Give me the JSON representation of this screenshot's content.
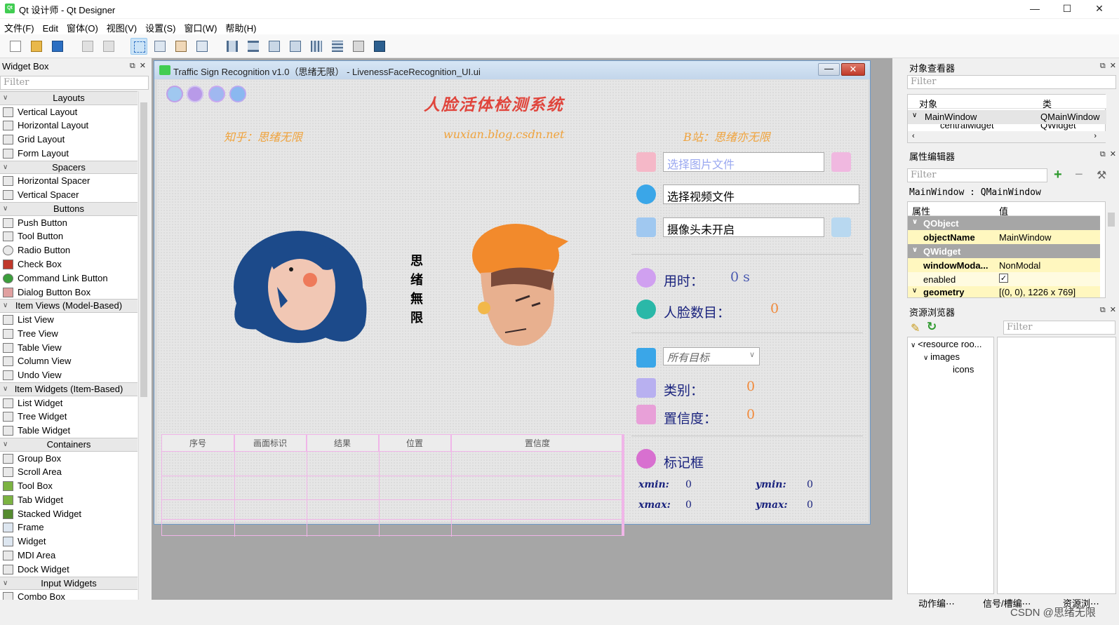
{
  "window": {
    "title": "Qt 设计师 - Qt Designer",
    "app_icon": "Qt",
    "minimize": "—",
    "maximize": "☐",
    "close": "✕"
  },
  "menubar": {
    "items": [
      "文件(F)",
      "Edit",
      "窗体(O)",
      "视图(V)",
      "设置(S)",
      "窗口(W)",
      "帮助(H)"
    ]
  },
  "widget_box": {
    "title": "Widget Box",
    "filter_placeholder": "Filter",
    "categories": [
      {
        "label": "Layouts",
        "items": [
          "Vertical Layout",
          "Horizontal Layout",
          "Grid Layout",
          "Form Layout"
        ]
      },
      {
        "label": "Spacers",
        "items": [
          "Horizontal Spacer",
          "Vertical Spacer"
        ]
      },
      {
        "label": "Buttons",
        "items": [
          "Push Button",
          "Tool Button",
          "Radio Button",
          "Check Box",
          "Command Link Button",
          "Dialog Button Box"
        ]
      },
      {
        "label": "Item Views (Model-Based)",
        "items": [
          "List View",
          "Tree View",
          "Table View",
          "Column View",
          "Undo View"
        ]
      },
      {
        "label": "Item Widgets (Item-Based)",
        "items": [
          "List Widget",
          "Tree Widget",
          "Table Widget"
        ]
      },
      {
        "label": "Containers",
        "items": [
          "Group Box",
          "Scroll Area",
          "Tool Box",
          "Tab Widget",
          "Stacked Widget",
          "Frame",
          "Widget",
          "MDI Area",
          "Dock Widget"
        ]
      },
      {
        "label": "Input Widgets",
        "items": [
          "Combo Box"
        ]
      }
    ]
  },
  "form": {
    "title": "Traffic Sign Recognition v1.0（思绪无限） - LivenessFaceRecognition_UI.ui",
    "main_title": "人脸活体检测系统",
    "links": {
      "zhihu": "知乎：思绪无限",
      "blog": "wuxian.blog.csdn.net",
      "bilibili": "B站：思绪亦无限"
    },
    "vertical_text": [
      "思",
      "绪",
      "無",
      "限"
    ],
    "image_field": "选择图片文件",
    "video_field": "选择视频文件",
    "camera_field": "摄像头未开启",
    "time_label": "用时：",
    "time_value": "0 s",
    "face_count_label": "人脸数目：",
    "face_count_value": "0",
    "target_select": "所有目标",
    "class_label": "类别：",
    "class_value": "0",
    "confidence_label": "置信度：",
    "confidence_value": "0",
    "bbox_label": "标记框",
    "xmin_label": "xmin:",
    "xmin_value": "0",
    "ymin_label": "ymin:",
    "ymin_value": "0",
    "xmax_label": "xmax:",
    "xmax_value": "0",
    "ymax_label": "ymax:",
    "ymax_value": "0",
    "table_headers": [
      "序号",
      "画面标识",
      "结果",
      "位置",
      "置信度"
    ]
  },
  "object_inspector": {
    "title": "对象查看器",
    "filter_placeholder": "Filter",
    "col_object": "对象",
    "col_class": "类",
    "rows": [
      {
        "object": "MainWindow",
        "class": "QMainWindow"
      },
      {
        "object": "centralwidget",
        "class": "QWidget"
      }
    ]
  },
  "property_editor": {
    "title": "属性编辑器",
    "filter_placeholder": "Filter",
    "context": "MainWindow : QMainWindow",
    "col_prop": "属性",
    "col_value": "值",
    "rows": [
      {
        "name": "QObject",
        "value": "",
        "group": true
      },
      {
        "name": "objectName",
        "value": "MainWindow",
        "bold": true
      },
      {
        "name": "QWidget",
        "value": "",
        "group": true
      },
      {
        "name": "windowModa...",
        "value": "NonModal",
        "bold": true
      },
      {
        "name": "enabled",
        "value": "✓"
      },
      {
        "name": "geometry",
        "value": "[(0, 0), 1226 x 769]",
        "bold": true
      }
    ]
  },
  "resource_browser": {
    "title": "资源浏览器",
    "filter_placeholder": "Filter",
    "tree": [
      "<resource roo...",
      "images",
      "icons"
    ],
    "tabs": [
      "动作编⋯",
      "信号/槽编⋯",
      "资源浏⋯"
    ]
  },
  "watermark": "CSDN @思绪无限"
}
